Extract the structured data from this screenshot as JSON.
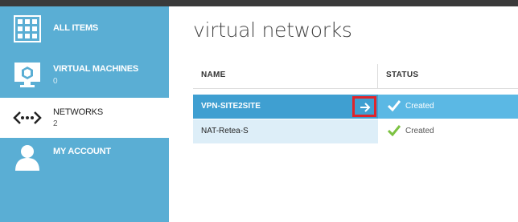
{
  "sidebar": {
    "items": [
      {
        "label": "ALL ITEMS",
        "count": "",
        "icon": "grid-icon"
      },
      {
        "label": "VIRTUAL MACHINES",
        "count": "0",
        "icon": "virtual-machine-icon"
      },
      {
        "label": "NETWORKS",
        "count": "2",
        "icon": "network-icon"
      },
      {
        "label": "MY ACCOUNT",
        "count": "",
        "icon": "user-icon"
      }
    ],
    "active_index": 2
  },
  "main": {
    "title": "virtual networks",
    "columns": {
      "name": "NAME",
      "status": "STATUS"
    },
    "rows": [
      {
        "name": "VPN-SITE2SITE",
        "status": "Created",
        "selected": true
      },
      {
        "name": "NAT-Retea-S",
        "status": "Created",
        "selected": false
      }
    ],
    "go_arrow_glyph": "→"
  },
  "colors": {
    "sidebar_bg": "#5aaed4",
    "selected_row": "#3f9fd1",
    "selected_status": "#5bb8e4",
    "status_check": "#7cc242",
    "highlight_box": "#e0242a"
  }
}
